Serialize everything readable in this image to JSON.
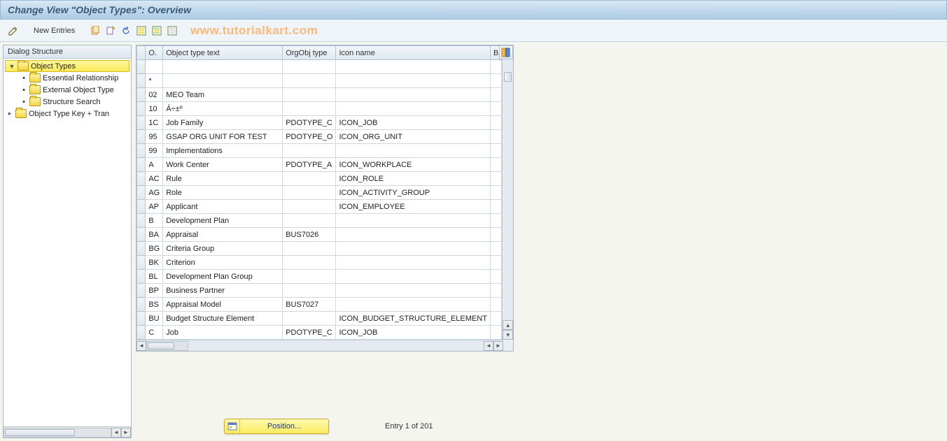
{
  "title": "Change View \"Object Types\": Overview",
  "toolbar": {
    "new_entries_label": "New Entries"
  },
  "watermark": "www.tutorialkart.com",
  "tree": {
    "header": "Dialog Structure",
    "nodes": [
      {
        "label": "Object Types",
        "level": 0,
        "expanded": true,
        "selected": true,
        "open": true
      },
      {
        "label": "Essential Relationship",
        "level": 1,
        "expanded": false,
        "selected": false,
        "open": false
      },
      {
        "label": "External Object Type",
        "level": 1,
        "expanded": false,
        "selected": false,
        "open": false
      },
      {
        "label": "Structure Search",
        "level": 1,
        "expanded": false,
        "selected": false,
        "open": false
      },
      {
        "label": "Object Type Key + Tran",
        "level": 0,
        "expanded": false,
        "selected": false,
        "open": false
      }
    ]
  },
  "table": {
    "headers": {
      "o": "O.",
      "text": "Object type text",
      "org": "OrgObj type",
      "icon": "Icon name",
      "b": "B"
    },
    "rows": [
      {
        "o": "",
        "text": "",
        "org": "",
        "icon": ""
      },
      {
        "o": "*",
        "text": "",
        "org": "",
        "icon": ""
      },
      {
        "o": "02",
        "text": "MEO Team",
        "org": "",
        "icon": ""
      },
      {
        "o": "10",
        "text": "Á÷±º",
        "org": "",
        "icon": ""
      },
      {
        "o": "1C",
        "text": "Job Family",
        "org": "PDOTYPE_C",
        "icon": "ICON_JOB"
      },
      {
        "o": "95",
        "text": "GSAP ORG UNIT FOR TEST",
        "org": "PDOTYPE_O",
        "icon": "ICON_ORG_UNIT"
      },
      {
        "o": "99",
        "text": "Implementations",
        "org": "",
        "icon": ""
      },
      {
        "o": "A",
        "text": "Work Center",
        "org": "PDOTYPE_A",
        "icon": "ICON_WORKPLACE"
      },
      {
        "o": "AC",
        "text": "Rule",
        "org": "",
        "icon": "ICON_ROLE"
      },
      {
        "o": "AG",
        "text": "Role",
        "org": "",
        "icon": "ICON_ACTIVITY_GROUP"
      },
      {
        "o": "AP",
        "text": "Applicant",
        "org": "",
        "icon": "ICON_EMPLOYEE"
      },
      {
        "o": "B",
        "text": "Development Plan",
        "org": "",
        "icon": ""
      },
      {
        "o": "BA",
        "text": "Appraisal",
        "org": "BUS7026",
        "icon": ""
      },
      {
        "o": "BG",
        "text": "Criteria Group",
        "org": "",
        "icon": ""
      },
      {
        "o": "BK",
        "text": "Criterion",
        "org": "",
        "icon": ""
      },
      {
        "o": "BL",
        "text": "Development Plan Group",
        "org": "",
        "icon": ""
      },
      {
        "o": "BP",
        "text": "Business Partner",
        "org": "",
        "icon": ""
      },
      {
        "o": "BS",
        "text": "Appraisal Model",
        "org": "BUS7027",
        "icon": ""
      },
      {
        "o": "BU",
        "text": "Budget Structure Element",
        "org": "",
        "icon": "ICON_BUDGET_STRUCTURE_ELEMENT"
      },
      {
        "o": "C",
        "text": "Job",
        "org": "PDOTYPE_C",
        "icon": "ICON_JOB"
      }
    ]
  },
  "footer": {
    "position_label": "Position...",
    "entry_counter": "Entry 1 of 201"
  }
}
